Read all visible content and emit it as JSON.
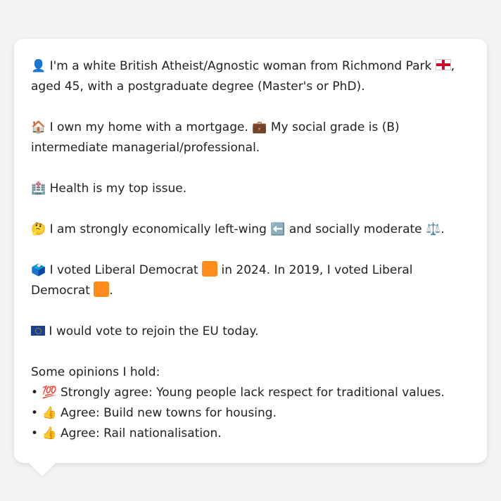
{
  "profile": {
    "identity": {
      "icon": "person-silhouette-icon",
      "text_a": "I'm a white British Atheist/Agnostic woman from Richmond Park",
      "text_b": ", aged 45, with a postgraduate degree (Master's or PhD)."
    },
    "housing": {
      "home_icon": "house-icon",
      "text_a": "I own my home with a mortgage.",
      "briefcase_icon": "briefcase-icon",
      "text_b": "My social grade is (B) intermediate managerial/professional."
    },
    "issue": {
      "icon": "hospital-icon",
      "text": "Health is my top issue."
    },
    "ideology": {
      "icon": "thinking-face-icon",
      "text_a": "I am strongly economically left-wing",
      "left_icon": "left-arrow-icon",
      "text_b": "and socially moderate",
      "scales_icon": "balance-scale-icon",
      "text_c": "."
    },
    "voting": {
      "icon": "ballot-box-icon",
      "text_a": "I voted Liberal Democrat",
      "text_b": "in 2024. In 2019, I voted Liberal Democrat",
      "text_c": ".",
      "party_color": "#ff8c1a"
    },
    "eu": {
      "icon": "eu-flag-icon",
      "text": "I would vote to rejoin the EU today."
    },
    "opinions": {
      "heading": "Some opinions I hold:",
      "items": [
        {
          "bullet": "•",
          "icon": "hundred-points-icon",
          "glyph": "💯",
          "text": "Strongly agree: Young people lack respect for traditional values."
        },
        {
          "bullet": "•",
          "icon": "thumbs-up-icon",
          "glyph": "👍",
          "text": "Agree: Build new towns for housing."
        },
        {
          "bullet": "•",
          "icon": "thumbs-up-icon",
          "glyph": "👍",
          "text": "Agree: Rail nationalisation."
        }
      ]
    }
  },
  "colors": {
    "background": "#f1f3f5",
    "bubble": "#ffffff",
    "text": "#222222",
    "party_orange": "#ff8c1a"
  }
}
